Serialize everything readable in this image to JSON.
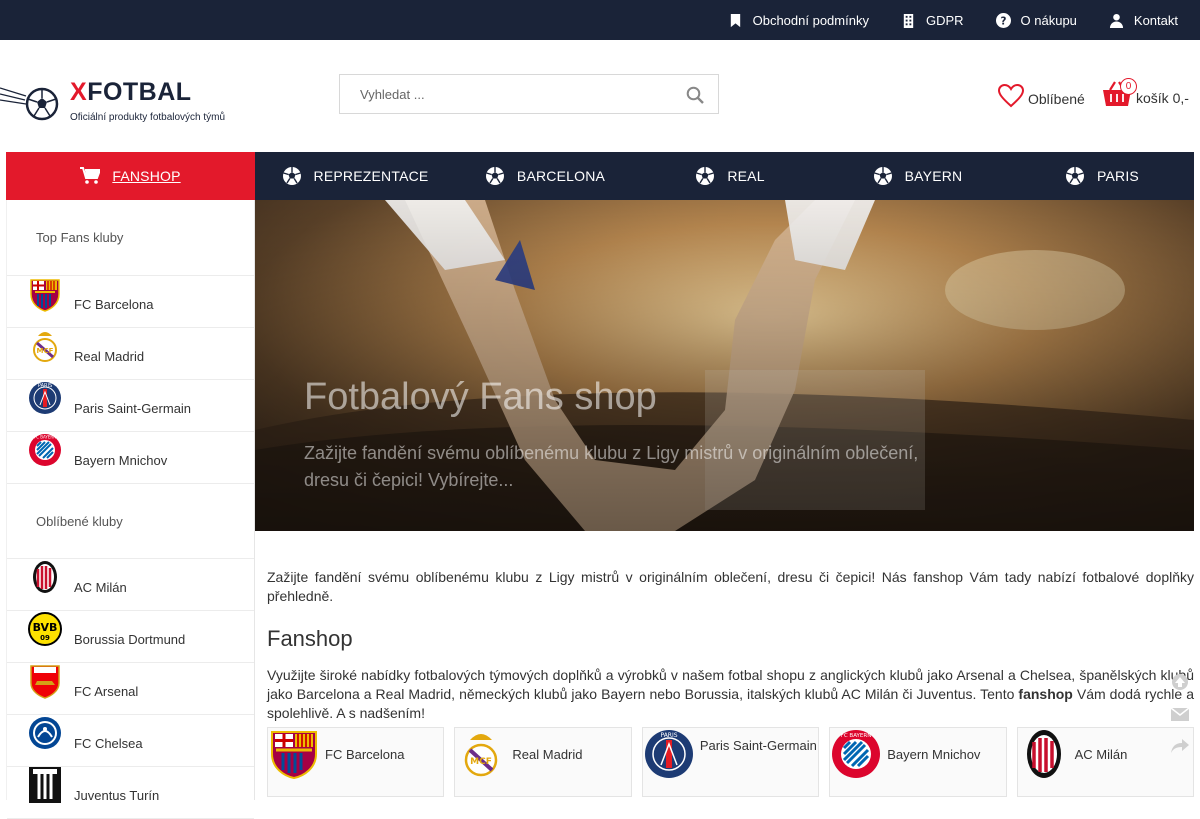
{
  "topbar": {
    "links": [
      {
        "label": "Obchodní podmínky",
        "icon": "bookmark-icon"
      },
      {
        "label": "GDPR",
        "icon": "building-icon"
      },
      {
        "label": "O nákupu",
        "icon": "question-icon"
      },
      {
        "label": "Kontakt",
        "icon": "user-icon"
      }
    ]
  },
  "header": {
    "logo_x": "X",
    "logo_rest": "FOTBAL",
    "tagline": "Oficiální produkty fotbalových týmů",
    "search_placeholder": "Vyhledat ...",
    "favorites_label": "Oblíbené",
    "cart_label": "košík 0,-",
    "cart_count": "0"
  },
  "nav": {
    "items": [
      {
        "label": "FANSHOP",
        "icon": "cart-icon",
        "active": true
      },
      {
        "label": "REPREZENTACE",
        "icon": "football-icon"
      },
      {
        "label": "BARCELONA",
        "icon": "football-icon"
      },
      {
        "label": "REAL",
        "icon": "football-icon"
      },
      {
        "label": "BAYERN",
        "icon": "football-icon"
      },
      {
        "label": "PARIS",
        "icon": "football-icon"
      }
    ]
  },
  "sidebar": {
    "top_heading": "Top Fans kluby",
    "top_items": [
      "FC Barcelona",
      "Real Madrid",
      "Paris Saint-Germain",
      "Bayern Mnichov"
    ],
    "fav_heading": "Oblíbené kluby",
    "fav_items": [
      "AC Milán",
      "Borussia Dortmund",
      "FC Arsenal",
      "FC Chelsea",
      "Juventus Turín"
    ]
  },
  "hero": {
    "title": "Fotbalový Fans shop",
    "subtitle": "Zažijte fandění svému oblíbenému klubu z Ligy mistrů v originálním oblečení, dresu či čepici! Vybírejte..."
  },
  "content": {
    "intro": "Zažijte fandění svému oblíbenému klubu z Ligy mistrů v originálním oblečení, dresu či čepici! Nás fanshop Vám tady nabízí fotbalové doplňky přehledně.",
    "heading": "Fanshop",
    "body_start": "Využijte široké nabídky fotbalových týmových doplňků a výrobků v našem fotbal shopu z anglických klubů jako Arsenal a Chelsea, španělských klubů jako Barcelona a Real Madrid, německých klubů jako Bayern nebo Borussia, italských klubů AC Milán či Juventus. Tento ",
    "body_bold": "fanshop",
    "body_end": " Vám dodá rychle a spolehlivě. A s nadšením!"
  },
  "cards": [
    "FC Barcelona",
    "Real Madrid",
    "Paris Saint-Germain",
    "Bayern Mnichov",
    "AC Milán"
  ],
  "colors": {
    "navy": "#1a2338",
    "red": "#e3192b"
  }
}
